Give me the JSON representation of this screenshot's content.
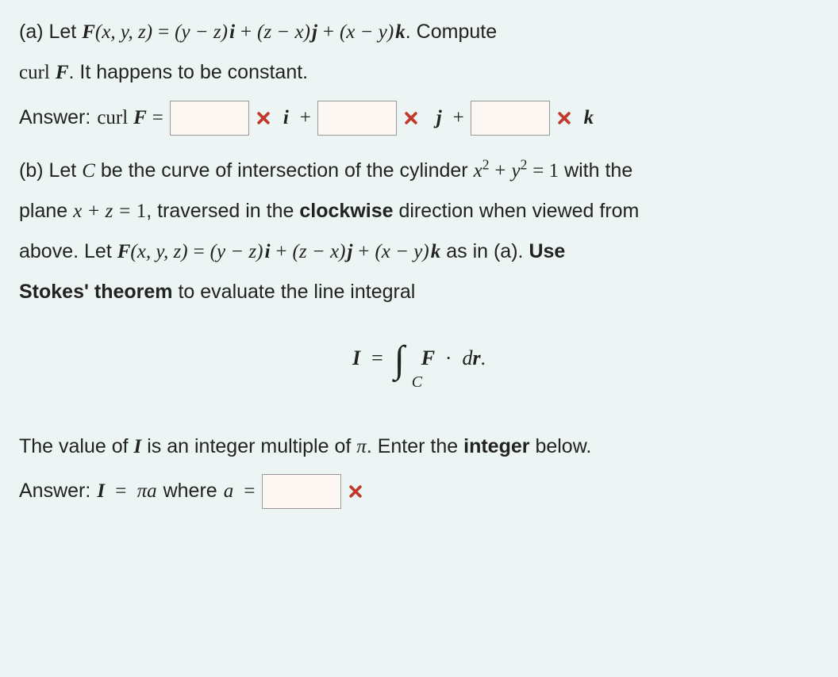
{
  "partA": {
    "label": "(a) Let",
    "F_of": "F",
    "args": "(x, y, z)",
    "eq": "=",
    "term1_a": "(y − z)",
    "i": "i",
    "plus": "+",
    "term2_a": "(z − x)",
    "j": "j",
    "term3_a": "(x − y)",
    "k": "k",
    "tail": ". Compute",
    "line2_pre": "curl",
    "line2_F": "F",
    "line2_tail": ". It happens to be constant.",
    "answer_label": "Answer:",
    "answer_curl": "curl",
    "answer_F": "F",
    "i_plus": "i  +",
    "j_plus": "j  +",
    "final_k": "k",
    "input_i": "",
    "input_j": "",
    "input_k": ""
  },
  "partB": {
    "label": "(b) Let",
    "C": "C",
    "text1": "be the curve of intersection of the cylinder",
    "cyl_x": "x",
    "cyl_plus": "+",
    "cyl_y": "y",
    "cyl_eq": "= 1",
    "text1_tail": "with the",
    "text2_pre": "plane",
    "plane_eq": "x + z = ",
    "plane_val": "1",
    "text2_mid": ", traversed in the",
    "clockwise": "clockwise",
    "text2_tail": "direction when viewed from",
    "text3_pre": "above. Let",
    "F_def_F": "F",
    "F_args": "(x, y, z)",
    "eq": "=",
    "term1": "(y − z)",
    "i": "i",
    "plus": "+",
    "term2": "(z − x)",
    "j": "j",
    "term3": "(x − y)",
    "k": "k",
    "text3_tail": " as in (a).",
    "use": "Use",
    "stokes": "Stokes' theorem",
    "text4": "to evaluate the line integral",
    "I": "I",
    "disp_eq": "=",
    "int_sub": "C",
    "F_vec": "F",
    "dot": "·",
    "dr_d": "d",
    "dr_r": "r",
    "period": ".",
    "text5_pre": "The value of",
    "text5_I": "I",
    "text5_mid": "is an integer multiple of",
    "pi": "π",
    "text5_tail": ". Enter the",
    "integer": "integer",
    "text5_end": "below.",
    "ans_label": "Answer:",
    "ans_I": "I",
    "ans_eq": "=",
    "ans_pi": "π",
    "ans_a": "a",
    "ans_where": "where",
    "ans_a2": "a",
    "ans_eq2": "=",
    "input_a": ""
  }
}
